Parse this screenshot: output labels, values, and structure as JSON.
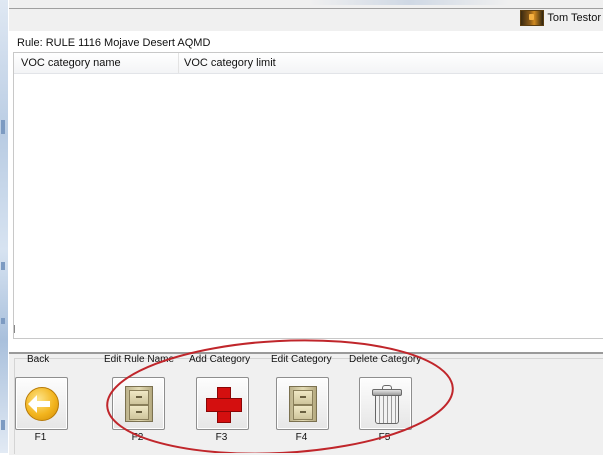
{
  "window": {
    "user_name": "Tom Testor"
  },
  "rule": {
    "label": "Rule: RULE 1116 Mojave Desert AQMD"
  },
  "table": {
    "columns": [
      "VOC category name",
      "VOC category limit"
    ],
    "rows": []
  },
  "toolbar": {
    "buttons": [
      {
        "label": "Back",
        "key": "F1",
        "icon": "back-arrow-icon"
      },
      {
        "label": "Edit Rule Name",
        "key": "F2",
        "icon": "filing-cabinet-icon"
      },
      {
        "label": "Add Category",
        "key": "F3",
        "icon": "red-plus-icon"
      },
      {
        "label": "Edit Category",
        "key": "F4",
        "icon": "filing-cabinet-icon"
      },
      {
        "label": "Delete Category",
        "key": "F5",
        "icon": "trash-can-icon"
      }
    ]
  },
  "annotation": {
    "color": "#c0262b"
  }
}
